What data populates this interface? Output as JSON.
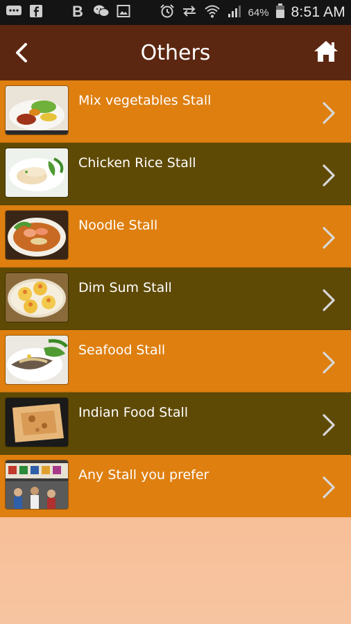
{
  "status_bar": {
    "battery_percent": "64%",
    "time": "8:51 AM",
    "icons": [
      "chat-icon",
      "facebook-icon",
      "b-icon",
      "wechat-icon",
      "image-icon",
      "alarm-icon",
      "sync-icon",
      "wifi-icon",
      "signal-icon",
      "battery-icon"
    ]
  },
  "app_bar": {
    "title": "Others",
    "back_icon": "back-arrow-icon",
    "home_icon": "home-icon",
    "background": "#5c2711"
  },
  "list": {
    "items": [
      {
        "label": "Mix vegetables Stall",
        "thumb": "mixed-vegetables-image"
      },
      {
        "label": "Chicken Rice Stall",
        "thumb": "chicken-rice-image"
      },
      {
        "label": "Noodle Stall",
        "thumb": "noodle-image"
      },
      {
        "label": "Dim Sum Stall",
        "thumb": "dim-sum-image"
      },
      {
        "label": "Seafood Stall",
        "thumb": "seafood-image"
      },
      {
        "label": "Indian Food Stall",
        "thumb": "indian-food-image"
      },
      {
        "label": "Any Stall you prefer",
        "thumb": "food-court-image"
      }
    ],
    "colors": {
      "orange": "#de7f0f",
      "dark": "#5f4a05"
    }
  }
}
